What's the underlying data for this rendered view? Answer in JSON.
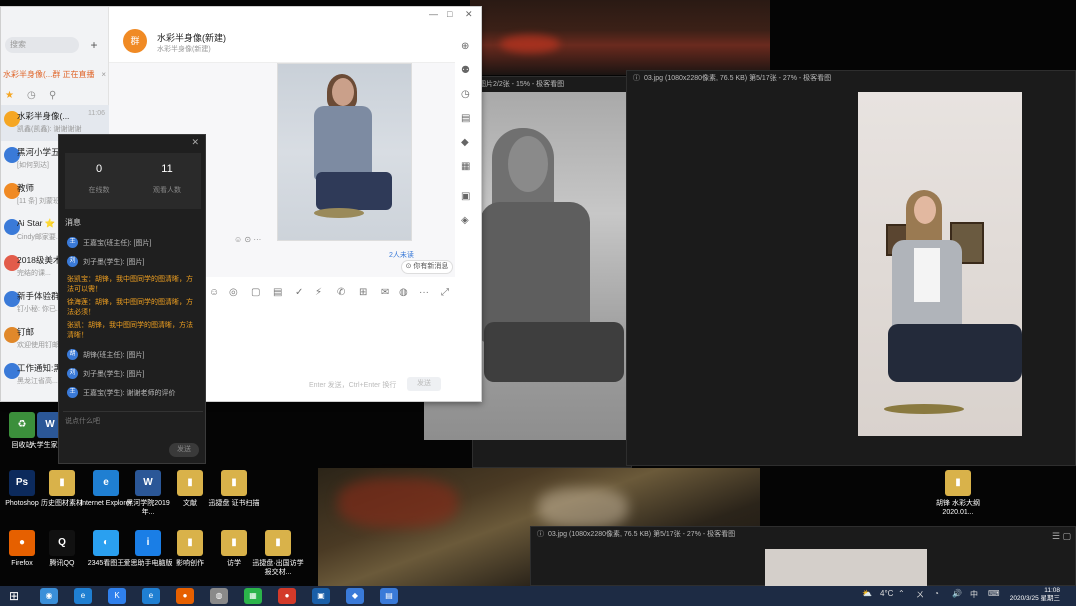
{
  "chat": {
    "search_placeholder": "搜索",
    "add_button": "+",
    "notice": "水彩半身像(...群 正在直播",
    "notice_close": "×",
    "side_tabs": [
      "★",
      "◷",
      "⚲"
    ],
    "conversations": [
      {
        "name": "水彩半身像(...",
        "snippet": "凯鑫(凯鑫): 谢谢谢谢",
        "time": "11:06"
      },
      {
        "name": "黑河小学五...",
        "snippet": "[如何到达]",
        "time": ""
      },
      {
        "name": "教师",
        "snippet": "[11 条] 刘蒙班...",
        "time": ""
      },
      {
        "name": "Ai Star ⭐",
        "snippet": "Cindy邮家要...",
        "time": ""
      },
      {
        "name": "2018级美术...",
        "snippet": "完结的课...",
        "time": ""
      },
      {
        "name": "新手体验群",
        "snippet": "钉小秘: 你已...",
        "time": ""
      },
      {
        "name": "钉邮",
        "snippet": "欢迎使用钉邮...",
        "time": ""
      },
      {
        "name": "工作通知:黑...",
        "snippet": "黑龙江省高...",
        "time": ""
      }
    ],
    "header": {
      "avatar": "群",
      "title": "水彩半身像(新建)",
      "subtitle": "水彩半身像(新建)"
    },
    "window_controls": [
      "—",
      "□",
      "✕"
    ],
    "unread": "2人未读",
    "new_message": "⊙ 你有新消息",
    "toolbar": [
      "☺",
      "◎",
      "▢",
      "▤",
      "✓",
      "⚡",
      "✆",
      "⊞",
      "✉",
      "◍",
      "···",
      "⤢"
    ],
    "right_icons": [
      "⊕",
      "⚉",
      "◷",
      "▤",
      "◆",
      "▦",
      "▣",
      "◈"
    ],
    "send_hint": "Enter 发送，Ctrl+Enter 换行",
    "send_button": "发送"
  },
  "classroom": {
    "close": "✕",
    "stats": [
      {
        "value": "0",
        "label": "在线数"
      },
      {
        "value": "11",
        "label": "观看人数"
      }
    ],
    "heading": "消息",
    "messages": [
      {
        "avatar": "王",
        "text": "王嘉宝(班主任): [图片]"
      },
      {
        "avatar": "刘",
        "text": "刘子墨(学生): [图片]"
      }
    ],
    "highlights": [
      "张凯宝：胡锋，我中图同学的图清晰，方法可以需！",
      "徐海莲：胡锋，我中图同学的图清晰，方法必须！",
      "张凯：胡锋，我中图同学的图清晰，方法清晰！"
    ],
    "messages2": [
      {
        "avatar": "胡",
        "text": "胡锋(班主任): [图片]"
      },
      {
        "avatar": "刘",
        "text": "刘子墨(学生): [图片]"
      },
      {
        "avatar": "王",
        "text": "王嘉宝(学生): 谢谢老师的评价"
      }
    ],
    "input_placeholder": "说点什么吧",
    "send_button": "发送"
  },
  "viewers": [
    {
      "title": "图片2/2张 - 15% - 极客看图"
    },
    {
      "title": "03.jpg (1080x2280像素, 76.5 KB)  第5/17张 - 27% - 极客看图"
    },
    {
      "title": "03.jpg (1080x2280像素, 76.5 KB)  第5/17张 - 27% - 极客看图",
      "controls": "☰ ▢"
    }
  ],
  "desktop_icons": [
    {
      "label": "回收站",
      "glyph": "♻",
      "color": "#3b8f3b"
    },
    {
      "label": "大学生家教...",
      "glyph": "W",
      "color": "#2b5797"
    },
    {
      "label": "Photoshop",
      "glyph": "Ps",
      "color": "#0c2a5c"
    },
    {
      "label": "历史图材素材",
      "glyph": "▮",
      "color": "#d9b24a"
    },
    {
      "label": "Internet Explorer",
      "glyph": "e",
      "color": "#1f7fd2"
    },
    {
      "label": "黑河学院2019年...",
      "glyph": "W",
      "color": "#2b5797"
    },
    {
      "label": "文献",
      "glyph": "▮",
      "color": "#d9b24a"
    },
    {
      "label": "迅捷盘 证书扫描",
      "glyph": "▮",
      "color": "#d9b24a"
    },
    {
      "label": "Firefox",
      "glyph": "●",
      "color": "#e66000"
    },
    {
      "label": "腾讯QQ",
      "glyph": "Q",
      "color": "#111"
    },
    {
      "label": "2345看图王",
      "glyph": "◐",
      "color": "#2aa0f0"
    },
    {
      "label": "爱思助手电脑版",
      "glyph": "i",
      "color": "#1a7ee6"
    },
    {
      "label": "影响创作",
      "glyph": "▮",
      "color": "#d9b24a"
    },
    {
      "label": "访学",
      "glyph": "▮",
      "color": "#d9b24a"
    },
    {
      "label": "迅捷盘·出国访学报交材...",
      "glyph": "▮",
      "color": "#d9b24a"
    },
    {
      "label": "胡锋 水彩大纲2020.01...",
      "glyph": "▮",
      "color": "#d9b24a"
    }
  ],
  "taskbar": {
    "start": "⊞",
    "apps": [
      {
        "glyph": "◉",
        "color": "#3a8fd9"
      },
      {
        "glyph": "e",
        "color": "#1f7fd2"
      },
      {
        "glyph": "K",
        "color": "#2f80ed"
      },
      {
        "glyph": "e",
        "color": "#1f7fd2"
      },
      {
        "glyph": "●",
        "color": "#e66000"
      },
      {
        "glyph": "◍",
        "color": "#8a8a8a"
      },
      {
        "glyph": "▦",
        "color": "#2bb44a"
      },
      {
        "glyph": "●",
        "color": "#d33a2a"
      },
      {
        "glyph": "▣",
        "color": "#1a5fa8"
      },
      {
        "glyph": "◆",
        "color": "#3a7ad8"
      },
      {
        "glyph": "▤",
        "color": "#3a7ad8"
      }
    ],
    "tray": [
      "⛅",
      "4°C",
      "⌃",
      "ㄨ",
      "◔",
      "🔊",
      "中",
      "⌨"
    ],
    "time": "11:08",
    "date": "2020/3/25 星期三"
  }
}
